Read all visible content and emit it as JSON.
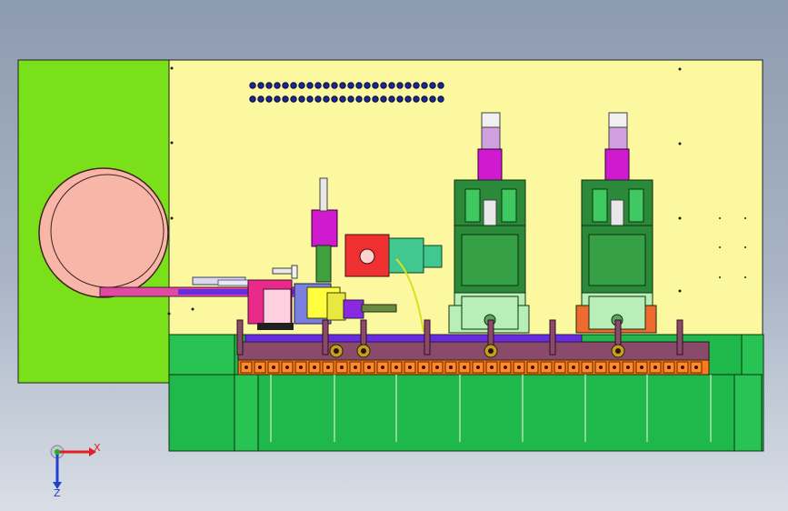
{
  "viewport": {
    "background_top": "#8d9bb0",
    "background_bottom": "#d9dee6"
  },
  "triad": {
    "x_label": "X",
    "z_label": "Z",
    "x_color": "#e02020",
    "y_color": "#20b020",
    "z_color": "#2040d0"
  },
  "model": {
    "plate_color": "#fcf8a0",
    "side_panel_color": "#7ae01a",
    "base_color": "#1fb84a",
    "reel_color": "#f7b6a8",
    "rail_color": "#8a4a6a",
    "blocks_color": "#ff7a1a",
    "press_green": "#b8efb8",
    "press_dark": "#2a8a3a",
    "cylinder_color": "#d01ad0",
    "feeder_bar_color": "#6a2ae0",
    "hole_rows": 2,
    "hole_cols": 24,
    "stations": 2
  }
}
